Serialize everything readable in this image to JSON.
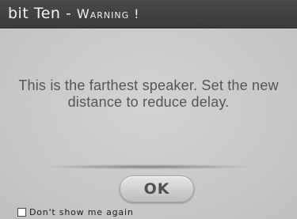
{
  "dialog": {
    "title_prefix": "bit Ten - ",
    "title_warning": "Warning !",
    "message": "This is the farthest speaker. Set the new distance to reduce delay.",
    "ok_label": "OK",
    "dont_show_label": "Don't show me again",
    "dont_show_checked": false
  },
  "icons": {
    "checkbox": "checkbox-unchecked-icon"
  },
  "colors": {
    "titlebar": "#3f3f3f",
    "background": "#c9c9c9",
    "message_text": "#555555",
    "button": "#d6d6d6"
  }
}
